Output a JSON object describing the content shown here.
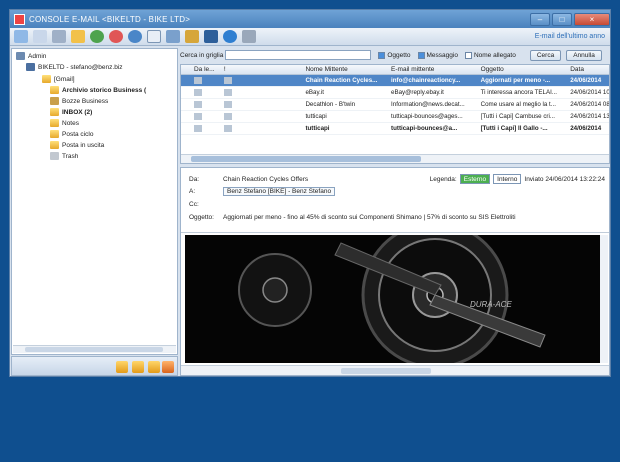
{
  "window": {
    "title": "CONSOLE E-MAIL <BIKELTD - BIKE LTD>",
    "controls": [
      "–",
      "□",
      "×"
    ]
  },
  "toolbar": {
    "right_label": "E-mail dell'ultimo anno",
    "icons": [
      "new-icon",
      "copy-icon",
      "delete-icon",
      "folder-icon",
      "send-receive-icon",
      "forward-icon",
      "reply-icon",
      "envelope-icon",
      "calendar-icon",
      "grid-icon",
      "monitor-icon",
      "help-icon",
      "exit-icon"
    ]
  },
  "tree": {
    "root": "Admin",
    "account": "BIKELTD - stefano@benz.biz",
    "folders": [
      {
        "label": "[Gmail]",
        "bold": false
      },
      {
        "label": "Archivio storico Business (",
        "bold": true
      },
      {
        "label": "Bozze Business",
        "bold": false
      },
      {
        "label": "INBOX (2)",
        "bold": true
      },
      {
        "label": "Notes",
        "bold": false
      },
      {
        "label": "Posta ciclo",
        "bold": false
      },
      {
        "label": "Posta in uscita",
        "bold": false
      },
      {
        "label": "Trash",
        "bold": false
      }
    ]
  },
  "search": {
    "label": "Cerca in griglia",
    "value": "",
    "opt_oggetto": "Oggetto",
    "opt_messaggio": "Messaggio",
    "opt_allegato": "Nome allegato",
    "btn_search": "Cerca",
    "btn_cancel": "Annulla"
  },
  "grid": {
    "headers": [
      "",
      "Da le...",
      "!",
      "Nome Mittente",
      "E-mail mittente",
      "Oggetto",
      "Data"
    ],
    "rows": [
      {
        "sender": "Chain Reaction Cycles...",
        "email": "info@chainreactioncy...",
        "subject": "Aggiornati per meno -...",
        "date": "24/06/2014",
        "bold": true,
        "selected": true
      },
      {
        "sender": "eBay.it",
        "email": "eBay@reply.ebay.it",
        "subject": "Ti interessa ancora TELAI...",
        "date": "24/06/2014 10:11:10",
        "bold": false,
        "selected": false
      },
      {
        "sender": "Decathlon - B'twin",
        "email": "Information@news.decat...",
        "subject": "Come usare al meglio la t...",
        "date": "24/06/2014 08:23:34",
        "bold": false,
        "selected": false
      },
      {
        "sender": "tutticapi",
        "email": "tutticapi-bounces@ages...",
        "subject": "[Tutti i Capi] Cambuse cri...",
        "date": "24/06/2014 13:55:56",
        "bold": false,
        "selected": false
      },
      {
        "sender": "tutticapi",
        "email": "tutticapi-bounces@a...",
        "subject": "[Tutti i Capi] Il Gallo -...",
        "date": "24/06/2014",
        "bold": true,
        "selected": false
      }
    ]
  },
  "preview": {
    "from_label": "Da:",
    "from_value": "Chain Reaction Cycles Offers",
    "to_label": "A:",
    "to_value": "Benz Stefano [BIKE] - Benz Stefano",
    "cc_label": "Cc:",
    "cc_value": "",
    "subject_label": "Oggetto:",
    "subject_value": "Aggiornati per meno - fino al 45% di sconto sui Componenti Shimano | 57% di sconto su SIS Elettroliti",
    "legend_label": "Legenda:",
    "legend_external": "Esterno",
    "legend_internal": "Interno",
    "sent_info": "Inviato 24/06/2014 13:22:24",
    "image_text": "DURA-ACE"
  }
}
